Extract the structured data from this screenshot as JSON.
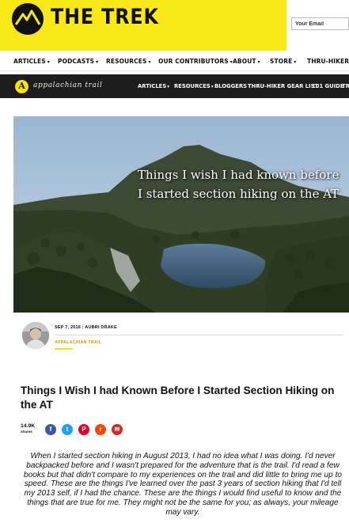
{
  "header": {
    "brand": "THE TREK",
    "email_placeholder": "Your Email",
    "colors": {
      "brand_yellow": "#f9e819",
      "dark_bar": "#1d1d1d",
      "category_gold": "#b9a20a"
    }
  },
  "nav": {
    "items": [
      {
        "label": "ARTICLES",
        "caret": "▾"
      },
      {
        "label": "PODCASTS",
        "caret": "▾"
      },
      {
        "label": "RESOURCES",
        "caret": "▾"
      },
      {
        "label": "OUR CONTRIBUTORS",
        "caret": "▾"
      },
      {
        "label": "ABOUT",
        "caret": "▾"
      },
      {
        "label": "STORE",
        "caret": "▾"
      },
      {
        "label": "THRU-HIKER GE",
        "caret": ""
      }
    ]
  },
  "subnav": {
    "badge_letter": "A",
    "brand": "appalachian trail",
    "items": [
      {
        "label": "ARTICLES",
        "caret": "▾"
      },
      {
        "label": "RESOURCES",
        "caret": "▾"
      },
      {
        "label": "BLOGGERS",
        "caret": ""
      },
      {
        "label": "THRU-HIKER GEAR LIST",
        "caret": ""
      },
      {
        "label": "101 GUIDE",
        "caret": ""
      },
      {
        "label": "TR",
        "caret": ""
      }
    ]
  },
  "hero": {
    "title_line1": "Things I wish I had known before",
    "title_line2": "I started section hiking on the AT"
  },
  "meta": {
    "date_author": "SEP 7, 2016 : AUBRI DRAKE",
    "category": "APPALACHIAN TRAIL"
  },
  "article": {
    "title": "Things I Wish I had Known Before I Started Section Hiking on the AT",
    "share_count": "14.9K",
    "share_word": "shares",
    "social_icons": [
      {
        "name": "facebook-icon",
        "glyph": "f",
        "color": "#3b5998"
      },
      {
        "name": "twitter-icon",
        "glyph": "t",
        "color": "#1da1f2"
      },
      {
        "name": "pinterest-icon",
        "glyph": "P",
        "color": "#e60023"
      },
      {
        "name": "reddit-icon",
        "glyph": "r",
        "color": "#ff4500"
      },
      {
        "name": "email-icon",
        "glyph": "✉",
        "color": "#d62828"
      }
    ],
    "body": "When I started section hiking in August 2013, I had no idea what I was doing. I'd never backpacked before and I wasn't prepared for the adventure that is the trail. I'd read a few books but that didn't compare to my experiences on the trail and did little to bring me up to speed. These are the things I've learned over the past 3 years of section hiking that I'd tell my 2013 self, if I had the chance. These are the things I would find useful to know and the things that are true for me. They might not be the same for you; as always, your mileage may vary."
  }
}
